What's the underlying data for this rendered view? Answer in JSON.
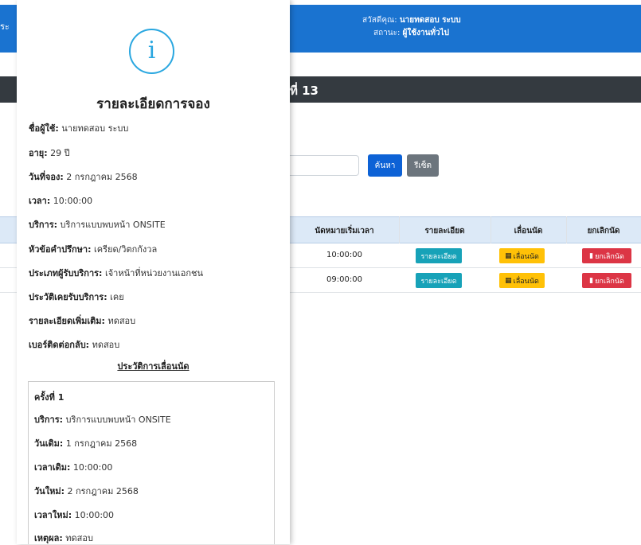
{
  "topbar": {
    "left_text": "ระ",
    "greeting_prefix": "สวัสดีคุณ:",
    "user_name": "นายทดสอบ ระบบ",
    "status_prefix": "สถานะ:",
    "status_value": "ผู้ใช้งานทั่วไป",
    "color": "#1a73d0"
  },
  "page": {
    "section_title": "ที่ 13"
  },
  "search": {
    "placeholder": "",
    "search_label": "ค้นหา",
    "reset_label": "รีเซ็ต"
  },
  "table": {
    "headers": [
      "นัดหมายเริ่มเวลา",
      "รายละเอียด",
      "เลื่อนนัด",
      "ยกเลิกนัด"
    ],
    "rows": [
      {
        "time": "10:00:00",
        "detail": "รายละเอียด",
        "postpone": "เลื่อนนัด",
        "cancel": "ยกเลิกนัด"
      },
      {
        "time": "09:00:00",
        "detail": "รายละเอียด",
        "postpone": "เลื่อนนัด",
        "cancel": "ยกเลิกนัด"
      }
    ]
  },
  "modal": {
    "icon": "info-icon",
    "icon_glyph": "i",
    "title": "รายละเอียดการจอง",
    "fields": [
      {
        "label": "ชื่อผู้ใช้:",
        "value": "นายทดสอบ ระบบ"
      },
      {
        "label": "อายุ:",
        "value": "29 ปี"
      },
      {
        "label": "วันที่จอง:",
        "value": "2 กรกฎาคม 2568"
      },
      {
        "label": "เวลา:",
        "value": "10:00:00"
      },
      {
        "label": "บริการ:",
        "value": "บริการแบบพบหน้า ONSITE"
      },
      {
        "label": "หัวข้อคำปรึกษา:",
        "value": "เครียด/วิตกกังวล"
      },
      {
        "label": "ประเภทผู้รับบริการ:",
        "value": "เจ้าหน้าที่หน่วยงานเอกชน"
      },
      {
        "label": "ประวัติเคยรับบริการ:",
        "value": "เคย"
      },
      {
        "label": "รายละเอียดเพิ่มเติม:",
        "value": "ทดสอบ"
      },
      {
        "label": "เบอร์ติดต่อกลับ:",
        "value": "ทดสอบ"
      }
    ],
    "history_title": "ประวัติการเลื่อนนัด",
    "history": {
      "round": "ครั้งที่ 1",
      "fields": [
        {
          "label": "บริการ:",
          "value": "บริการแบบพบหน้า ONSITE"
        },
        {
          "label": "วันเดิม:",
          "value": "1 กรกฎาคม 2568"
        },
        {
          "label": "เวลาเดิม:",
          "value": "10:00:00"
        },
        {
          "label": "วันใหม่:",
          "value": "2 กรกฎาคม 2568"
        },
        {
          "label": "เวลาใหม่:",
          "value": "10:00:00"
        },
        {
          "label": "เหตุผล:",
          "value": "ทดสอบ"
        }
      ]
    }
  }
}
